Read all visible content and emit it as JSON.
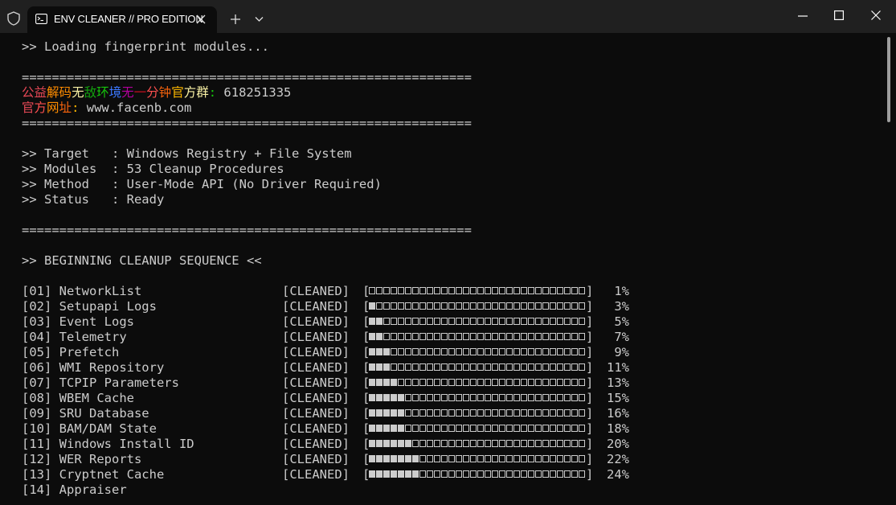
{
  "window": {
    "tab_title": "ENV CLEANER // PRO EDITION",
    "tab_icon": "terminal-icon"
  },
  "terminal": {
    "loading": ">> Loading fingerprint modules...",
    "separator": "============================================================",
    "promo": [
      {
        "text": "公",
        "color": "#e74856"
      },
      {
        "text": "益",
        "color": "#e74856"
      },
      {
        "text": "解",
        "color": "#ff8c00"
      },
      {
        "text": "码",
        "color": "#ff8c00"
      },
      {
        "text": "无",
        "color": "#f9f1a5"
      },
      {
        "text": "敌",
        "color": "#13a10e"
      },
      {
        "text": "环",
        "color": "#16c60c"
      },
      {
        "text": "境",
        "color": "#3b78ff"
      },
      {
        "text": "无",
        "color": "#b4009e"
      },
      {
        "text": "一",
        "color": "#c50f1f"
      },
      {
        "text": "分",
        "color": "#ff5050"
      },
      {
        "text": "钟",
        "color": "#f7630c"
      },
      {
        "text": "官",
        "color": "#ffb900"
      },
      {
        "text": "方",
        "color": "#f9f1a5"
      },
      {
        "text": "群",
        "color": "#f9f1a5"
      },
      {
        "text": ": ",
        "color": "#16c60c"
      },
      {
        "text": "618251335",
        "color": "#cccccc"
      }
    ],
    "site": [
      {
        "text": "官",
        "color": "#e74856"
      },
      {
        "text": "方",
        "color": "#ff5050"
      },
      {
        "text": "网",
        "color": "#ff8c00"
      },
      {
        "text": "址",
        "color": "#f7630c"
      },
      {
        "text": ": ",
        "color": "#ffb900"
      },
      {
        "text": "www.facenb.com",
        "color": "#cccccc"
      }
    ],
    "info": [
      ">> Target   : Windows Registry + File System",
      ">> Modules  : 53 Cleanup Procedures",
      ">> Method   : User-Mode API (No Driver Required)",
      ">> Status   : Ready"
    ],
    "sequence_header": ">> BEGINNING CLEANUP SEQUENCE <<",
    "status_label": "[CLEANED]",
    "bar_cells": 30,
    "items": [
      {
        "id": "[01]",
        "name": "NetworkList",
        "status": "[CLEANED]",
        "progress": 0.01,
        "percent": "1%"
      },
      {
        "id": "[02]",
        "name": "Setupapi Logs",
        "status": "[CLEANED]",
        "progress": 0.03,
        "percent": "3%"
      },
      {
        "id": "[03]",
        "name": "Event Logs",
        "status": "[CLEANED]",
        "progress": 0.05,
        "percent": "5%"
      },
      {
        "id": "[04]",
        "name": "Telemetry",
        "status": "[CLEANED]",
        "progress": 0.07,
        "percent": "7%"
      },
      {
        "id": "[05]",
        "name": "Prefetch",
        "status": "[CLEANED]",
        "progress": 0.09,
        "percent": "9%"
      },
      {
        "id": "[06]",
        "name": "WMI Repository",
        "status": "[CLEANED]",
        "progress": 0.11,
        "percent": "11%"
      },
      {
        "id": "[07]",
        "name": "TCPIP Parameters",
        "status": "[CLEANED]",
        "progress": 0.13,
        "percent": "13%"
      },
      {
        "id": "[08]",
        "name": "WBEM Cache",
        "status": "[CLEANED]",
        "progress": 0.15,
        "percent": "15%"
      },
      {
        "id": "[09]",
        "name": "SRU Database",
        "status": "[CLEANED]",
        "progress": 0.16,
        "percent": "16%"
      },
      {
        "id": "[10]",
        "name": "BAM/DAM State",
        "status": "[CLEANED]",
        "progress": 0.18,
        "percent": "18%"
      },
      {
        "id": "[11]",
        "name": "Windows Install ID",
        "status": "[CLEANED]",
        "progress": 0.2,
        "percent": "20%"
      },
      {
        "id": "[12]",
        "name": "WER Reports",
        "status": "[CLEANED]",
        "progress": 0.22,
        "percent": "22%"
      },
      {
        "id": "[13]",
        "name": "Cryptnet Cache",
        "status": "[CLEANED]",
        "progress": 0.24,
        "percent": "24%"
      },
      {
        "id": "[14]",
        "name": "Appraiser",
        "status": "",
        "progress": null,
        "percent": ""
      }
    ]
  }
}
